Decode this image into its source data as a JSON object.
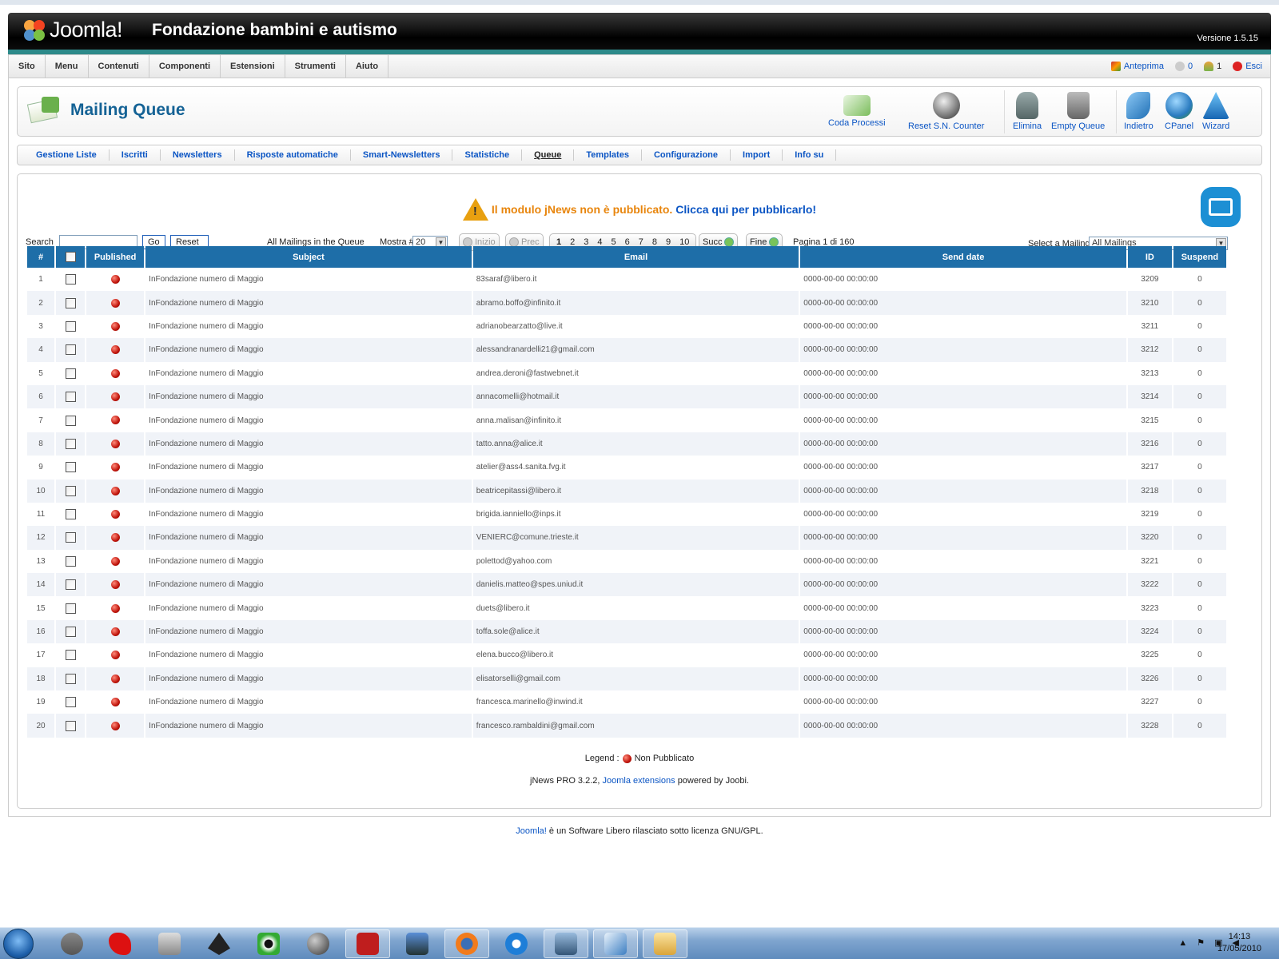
{
  "header": {
    "logo_text": "Joomla!",
    "site_title": "Fondazione bambini e autismo",
    "version": "Versione 1.5.15"
  },
  "menubar": {
    "items": [
      "Sito",
      "Menu",
      "Contenuti",
      "Componenti",
      "Estensioni",
      "Strumenti",
      "Aiuto"
    ],
    "preview": "Anteprima",
    "messages_count": "0",
    "users_count": "1",
    "logout": "Esci"
  },
  "toolbar": {
    "title": "Mailing Queue",
    "buttons": {
      "coda": "Coda Processi",
      "reset": "Reset S.N. Counter",
      "elimina": "Elimina",
      "empty": "Empty Queue",
      "indietro": "Indietro",
      "cpanel": "CPanel",
      "wizard": "Wizard"
    }
  },
  "subnav": {
    "items": [
      "Gestione Liste",
      "Iscritti",
      "Newsletters",
      "Risposte automatiche",
      "Smart-Newsletters",
      "Statistiche",
      "Queue",
      "Templates",
      "Configurazione",
      "Import",
      "Info su"
    ],
    "active": "Queue"
  },
  "warning": {
    "text": "Il modulo jNews non è pubblicato.",
    "link": "Clicca qui per pubblicarlo!"
  },
  "filters": {
    "search_label": "Search",
    "search_value": "",
    "go": "Go",
    "reset": "Reset",
    "all_mailings": "All Mailings in the Queue",
    "show_label": "Mostra #",
    "show_value": "20",
    "pagination": {
      "start": "Inizio",
      "prev": "Prec",
      "pages": [
        "1",
        "2",
        "3",
        "4",
        "5",
        "6",
        "7",
        "8",
        "9",
        "10"
      ],
      "next": "Succ",
      "end": "Fine",
      "page_info": "Pagina 1 di 160"
    },
    "select_label": "Select a Mailing",
    "select_value": "All Mailings"
  },
  "table": {
    "headers": [
      "#",
      "",
      "Published",
      "Subject",
      "Email",
      "Send date",
      "ID",
      "Suspend"
    ],
    "rows": [
      {
        "n": "1",
        "subject": "InFondazione numero di Maggio",
        "email": "83saraf@libero.it",
        "date": "0000-00-00 00:00:00",
        "id": "3209",
        "suspend": "0"
      },
      {
        "n": "2",
        "subject": "InFondazione numero di Maggio",
        "email": "abramo.boffo@infinito.it",
        "date": "0000-00-00 00:00:00",
        "id": "3210",
        "suspend": "0"
      },
      {
        "n": "3",
        "subject": "InFondazione numero di Maggio",
        "email": "adrianobearzatto@live.it",
        "date": "0000-00-00 00:00:00",
        "id": "3211",
        "suspend": "0"
      },
      {
        "n": "4",
        "subject": "InFondazione numero di Maggio",
        "email": "alessandranardelli21@gmail.com",
        "date": "0000-00-00 00:00:00",
        "id": "3212",
        "suspend": "0"
      },
      {
        "n": "5",
        "subject": "InFondazione numero di Maggio",
        "email": "andrea.deroni@fastwebnet.it",
        "date": "0000-00-00 00:00:00",
        "id": "3213",
        "suspend": "0"
      },
      {
        "n": "6",
        "subject": "InFondazione numero di Maggio",
        "email": "annacomelli@hotmail.it",
        "date": "0000-00-00 00:00:00",
        "id": "3214",
        "suspend": "0"
      },
      {
        "n": "7",
        "subject": "InFondazione numero di Maggio",
        "email": "anna.malisan@infinito.it",
        "date": "0000-00-00 00:00:00",
        "id": "3215",
        "suspend": "0"
      },
      {
        "n": "8",
        "subject": "InFondazione numero di Maggio",
        "email": "tatto.anna@alice.it",
        "date": "0000-00-00 00:00:00",
        "id": "3216",
        "suspend": "0"
      },
      {
        "n": "9",
        "subject": "InFondazione numero di Maggio",
        "email": "atelier@ass4.sanita.fvg.it",
        "date": "0000-00-00 00:00:00",
        "id": "3217",
        "suspend": "0"
      },
      {
        "n": "10",
        "subject": "InFondazione numero di Maggio",
        "email": "beatricepitassi@libero.it",
        "date": "0000-00-00 00:00:00",
        "id": "3218",
        "suspend": "0"
      },
      {
        "n": "11",
        "subject": "InFondazione numero di Maggio",
        "email": "brigida.ianniello@inps.it",
        "date": "0000-00-00 00:00:00",
        "id": "3219",
        "suspend": "0"
      },
      {
        "n": "12",
        "subject": "InFondazione numero di Maggio",
        "email": "VENIERC@comune.trieste.it",
        "date": "0000-00-00 00:00:00",
        "id": "3220",
        "suspend": "0"
      },
      {
        "n": "13",
        "subject": "InFondazione numero di Maggio",
        "email": "polettod@yahoo.com",
        "date": "0000-00-00 00:00:00",
        "id": "3221",
        "suspend": "0"
      },
      {
        "n": "14",
        "subject": "InFondazione numero di Maggio",
        "email": "danielis.matteo@spes.uniud.it",
        "date": "0000-00-00 00:00:00",
        "id": "3222",
        "suspend": "0"
      },
      {
        "n": "15",
        "subject": "InFondazione numero di Maggio",
        "email": "duets@libero.it",
        "date": "0000-00-00 00:00:00",
        "id": "3223",
        "suspend": "0"
      },
      {
        "n": "16",
        "subject": "InFondazione numero di Maggio",
        "email": "toffa.sole@alice.it",
        "date": "0000-00-00 00:00:00",
        "id": "3224",
        "suspend": "0"
      },
      {
        "n": "17",
        "subject": "InFondazione numero di Maggio",
        "email": "elena.bucco@libero.it",
        "date": "0000-00-00 00:00:00",
        "id": "3225",
        "suspend": "0"
      },
      {
        "n": "18",
        "subject": "InFondazione numero di Maggio",
        "email": "elisatorselli@gmail.com",
        "date": "0000-00-00 00:00:00",
        "id": "3226",
        "suspend": "0"
      },
      {
        "n": "19",
        "subject": "InFondazione numero di Maggio",
        "email": "francesca.marinello@inwind.it",
        "date": "0000-00-00 00:00:00",
        "id": "3227",
        "suspend": "0"
      },
      {
        "n": "20",
        "subject": "InFondazione numero di Maggio",
        "email": "francesco.rambaldini@gmail.com",
        "date": "0000-00-00 00:00:00",
        "id": "3228",
        "suspend": "0"
      }
    ]
  },
  "legend": {
    "label": "Legend :",
    "value": "Non Pubblicato"
  },
  "credits": {
    "prefix": "jNews PRO 3.2.2,",
    "link": "Joomla extensions",
    "suffix": "powered by Joobi."
  },
  "footer": {
    "link": "Joomla!",
    "text": "è un Software Libero rilasciato sotto licenza GNU/GPL."
  },
  "taskbar": {
    "time": "14:13",
    "date": "17/05/2010",
    "apps": [
      "gimp-icon",
      "paint-splat-icon",
      "floppy-icon",
      "inkscape-icon",
      "eye-icon",
      "sphere-icon",
      "filezilla-icon",
      "network-icon",
      "firefox-icon",
      "ie-icon",
      "remote-desktop-icon",
      "virtualbox-icon",
      "folder-icon"
    ]
  },
  "colors": {
    "accent": "#0b55c4",
    "header_row": "#1e6ea8",
    "warning": "#e8850c",
    "title": "#146295"
  }
}
